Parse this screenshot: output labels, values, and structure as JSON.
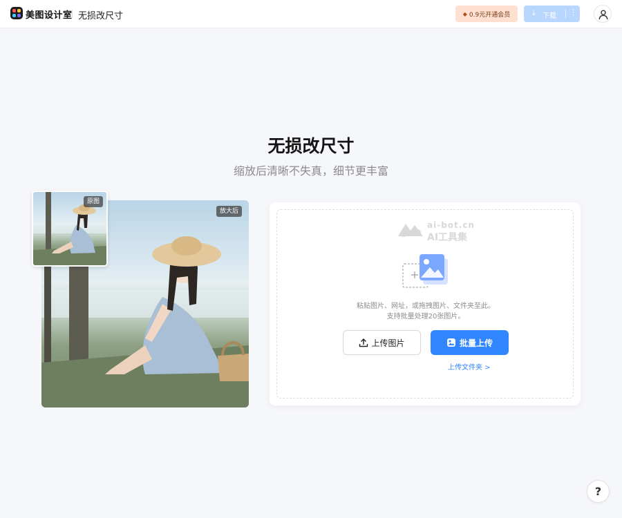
{
  "header": {
    "brand_name": "美图设计室",
    "page_name": "无损改尺寸",
    "vip_label": "0.9元开通会员",
    "download_label": "下载",
    "more_glyph": "⋮"
  },
  "hero": {
    "title": "无损改尺寸",
    "subtitle": "缩放后清晰不失真，细节更丰富"
  },
  "samples": {
    "after_tag": "放大后",
    "original_tag": "原图"
  },
  "upload": {
    "watermark_top": "ai-bot.cn",
    "watermark_bottom": "AI工具集",
    "hint_line1": "粘贴图片、网址，或拖拽图片、文件夹至此。",
    "hint_line2": "支持批量处理20张图片。",
    "upload_image_label": "上传图片",
    "batch_upload_label": "批量上传",
    "upload_folder_label": "上传文件夹 >"
  },
  "help": {
    "label": "?"
  },
  "colors": {
    "accent": "#2f86ff",
    "vip_bg": "#fde0cf",
    "page_bg": "#f6f7fb"
  }
}
